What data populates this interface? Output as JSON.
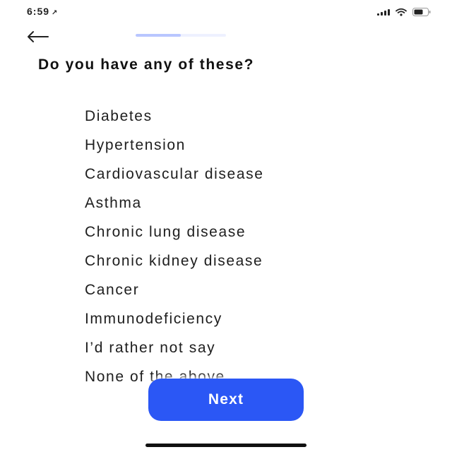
{
  "status_bar": {
    "time": "6:59",
    "icons": [
      "signal-icon",
      "wifi-icon",
      "battery-icon"
    ]
  },
  "header": {
    "back_icon": "arrow-left-icon",
    "progress": 0.5
  },
  "question": {
    "title": "Do you have any of these?"
  },
  "options": [
    "Diabetes",
    "Hypertension",
    "Cardiovascular disease",
    "Asthma",
    "Chronic lung disease",
    "Chronic kidney disease",
    "Cancer",
    "Immunodeficiency",
    "I’d rather not say",
    "None of the above"
  ],
  "footer": {
    "next_label": "Next"
  },
  "colors": {
    "accent": "#2b57f5",
    "progress": "#b9c6ff",
    "text": "#1e1e1e",
    "background": "#ffffff"
  }
}
